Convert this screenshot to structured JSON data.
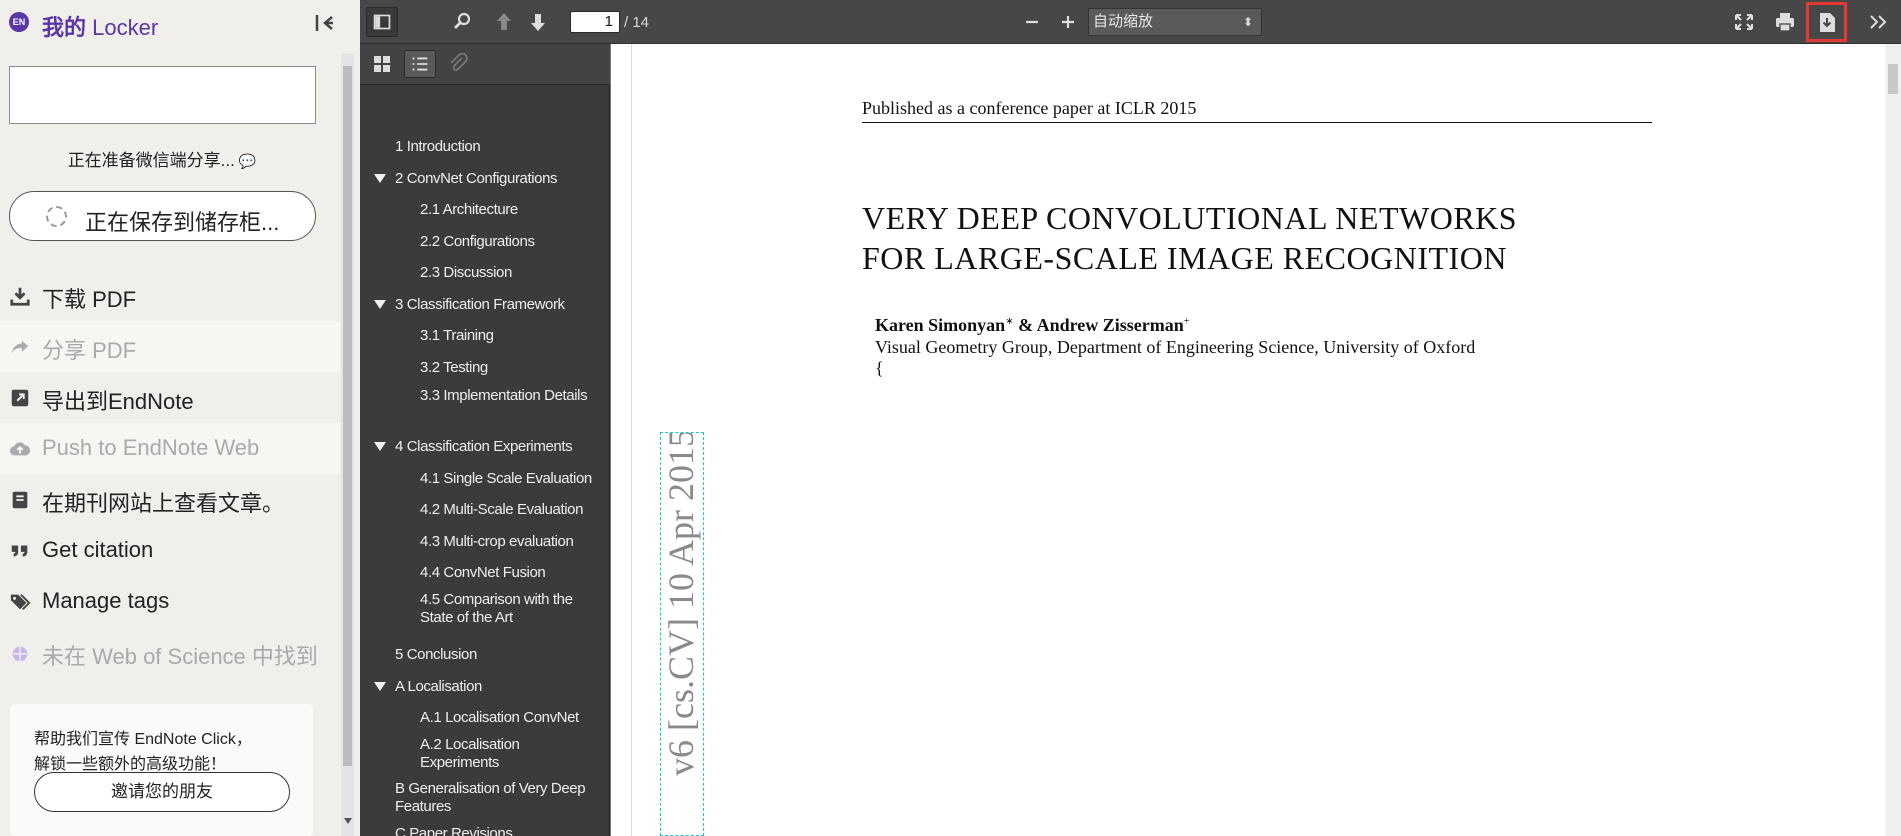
{
  "locker": {
    "badge": "EN",
    "title_cn": "我的",
    "title_en": "Locker",
    "preparing_share": "正在准备微信端分享...",
    "saving_label": "正在保存到储存柜...",
    "menu": [
      {
        "label": "下载 PDF",
        "icon": "download-icon"
      },
      {
        "label": "分享 PDF",
        "icon": "share-icon"
      },
      {
        "label": "导出到EndNote",
        "icon": "export-icon"
      },
      {
        "label": "Push to EndNote Web",
        "icon": "cloud-upload-icon"
      },
      {
        "label": "在期刊网站上查看文章。",
        "icon": "book-icon"
      },
      {
        "label": "Get citation",
        "icon": "quote-icon"
      },
      {
        "label": "Manage tags",
        "icon": "tags-icon"
      },
      {
        "label": "未在 Web of Science 中找到",
        "icon": "wos-icon"
      }
    ],
    "promo_line1": "帮助我们宣传 EndNote Click，",
    "promo_line2": "解锁一些额外的高级功能！",
    "invite_label": "邀请您的朋友"
  },
  "toolbar": {
    "current_page": "1",
    "page_count": "/ 14",
    "zoom_value": "自动缩放",
    "zoom_caret": "⬍"
  },
  "outline": [
    {
      "label": "1 Introduction",
      "level": 0
    },
    {
      "label": "2 ConvNet Configurations",
      "level": 0
    },
    {
      "label": "2.1 Architecture",
      "level": 1
    },
    {
      "label": "2.2 Configurations",
      "level": 1
    },
    {
      "label": "2.3 Discussion",
      "level": 1
    },
    {
      "label": "3 Classification Framework",
      "level": 0
    },
    {
      "label": "3.1 Training",
      "level": 1
    },
    {
      "label": "3.2 Testing",
      "level": 1
    },
    {
      "label": "3.3 Implementation Details",
      "level": 1
    },
    {
      "label": "4 Classification Experiments",
      "level": 0
    },
    {
      "label": "4.1 Single Scale Evaluation",
      "level": 1
    },
    {
      "label": "4.2 Multi-Scale Evaluation",
      "level": 1
    },
    {
      "label": "4.3 Multi-crop evaluation",
      "level": 1
    },
    {
      "label": "4.4 ConvNet Fusion",
      "level": 1
    },
    {
      "label": "4.5 Comparison with the State of the Art",
      "level": 1
    },
    {
      "label": "5 Conclusion",
      "level": 0
    },
    {
      "label": "A Localisation",
      "level": 0
    },
    {
      "label": "A.1 Localisation ConvNet",
      "level": 1
    },
    {
      "label": "A.2 Localisation Experiments",
      "level": 1
    },
    {
      "label": "B Generalisation of Very Deep Features",
      "level": 0
    },
    {
      "label": "C Paper Revisions",
      "level": 0
    }
  ],
  "document": {
    "running_head": "Published as a conference paper at ICLR 2015",
    "title_line1": "VERY DEEP CONVOLUTIONAL NETWORKS",
    "title_line2": "FOR LARGE-SCALE IMAGE RECOGNITION",
    "author1": "Karen Simonyan",
    "author1_mark": "∗",
    "author_sep": " & ",
    "author2": "Andrew Zisserman",
    "author2_mark": "+",
    "affiliation": "Visual Geometry Group, Department of Engineering Science, University of Oxford",
    "brace": "{",
    "arxiv_stamp": "v6 [cs.CV] 10 Apr 2015"
  },
  "colors": {
    "brand": "#5a35a8",
    "highlight": "#e53935",
    "toolbar": "#474747",
    "sidebar": "#3b3b3b"
  }
}
